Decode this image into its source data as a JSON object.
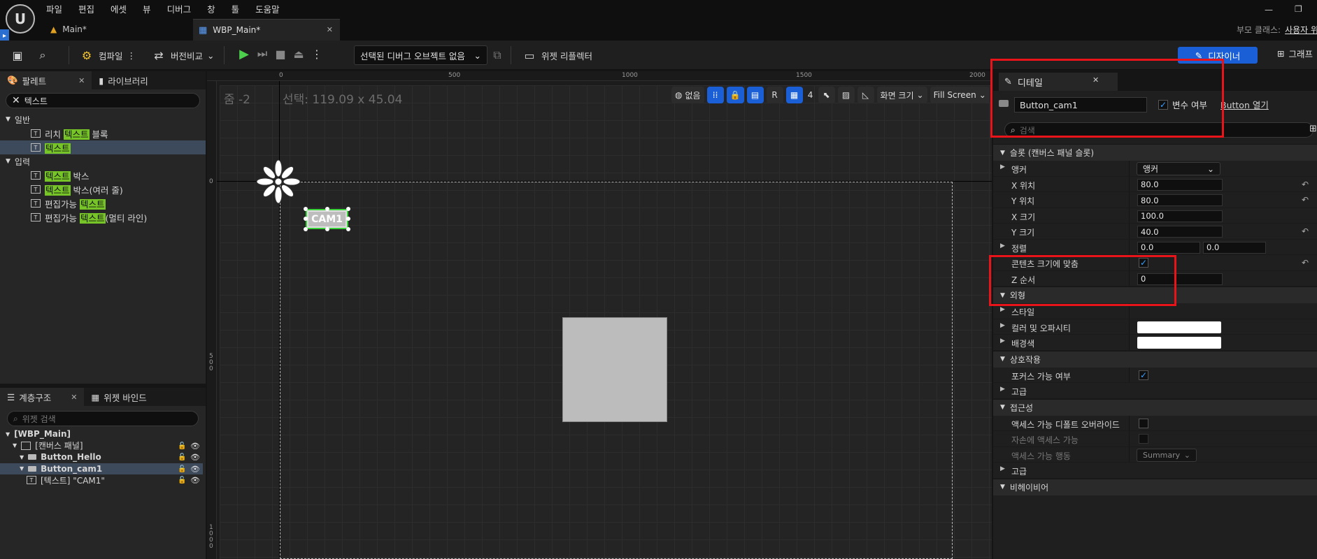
{
  "menu": [
    "파일",
    "편집",
    "에셋",
    "뷰",
    "디버그",
    "창",
    "툴",
    "도움말"
  ],
  "tabs": {
    "main": "Main*",
    "wbp": "WBP_Main*"
  },
  "parent_class": {
    "label": "부모 클래스:",
    "value": "사용자 위"
  },
  "toolbar": {
    "compile": "컴파일",
    "diff": "버전비교",
    "debug_object": "선택된 디버그 오브젝트 없음",
    "widget_reflector": "위젯 리플렉터",
    "designer": "디자이너",
    "graph": "그래프"
  },
  "palette": {
    "tab": "팔레트",
    "library_tab": "라이브러리",
    "search_value": "텍스트",
    "categories": [
      {
        "name": "일반",
        "items": [
          {
            "prefix": "리치 ",
            "hl": "텍스트",
            "suffix": " 블록",
            "icon": "rich-text-icon",
            "sel": false
          },
          {
            "prefix": "",
            "hl": "텍스트",
            "suffix": "",
            "icon": "text-icon",
            "sel": true
          }
        ]
      },
      {
        "name": "입력",
        "items": [
          {
            "prefix": "",
            "hl": "텍스트",
            "suffix": " 박스",
            "icon": "textbox-icon",
            "sel": false
          },
          {
            "prefix": "",
            "hl": "텍스트",
            "suffix": " 박스(여러 줄)",
            "icon": "textbox-multi-icon",
            "sel": false
          },
          {
            "prefix": "편집가능 ",
            "hl": "텍스트",
            "suffix": "",
            "icon": "editable-text-icon",
            "sel": false
          },
          {
            "prefix": "편집가능 ",
            "hl": "텍스트",
            "suffix": "(멀티 라인)",
            "icon": "editable-text-multi-icon",
            "sel": false
          }
        ]
      }
    ]
  },
  "hierarchy": {
    "tab": "계층구조",
    "bind_tab": "위젯 바인드",
    "search_placeholder": "위젯 검색",
    "items": [
      {
        "label": "[WBP_Main]",
        "level": 0,
        "sel": false
      },
      {
        "label": "[캔버스 패널]",
        "level": 1,
        "sel": false
      },
      {
        "label": "Button_Hello",
        "level": 2,
        "sel": false
      },
      {
        "label": "Button_cam1",
        "level": 2,
        "sel": true
      },
      {
        "label": "[텍스트] \"CAM1\"",
        "level": 3,
        "sel": false
      }
    ]
  },
  "canvas": {
    "zoom": "줌 -2",
    "selection": "선택: 119.09 x 45.04",
    "ruler_top": [
      "0",
      "500",
      "1000",
      "1500",
      "2000"
    ],
    "ruler_left": [
      "0",
      "5\n0\n0",
      "1\n0\n0\n0"
    ],
    "none_label": "없음",
    "r_label": "R",
    "grid_snap": "4",
    "screen_size": "화면 크기",
    "fill_screen": "Fill Screen",
    "button_text": "CAM1"
  },
  "details": {
    "tab": "디테일",
    "name": "Button_cam1",
    "is_variable": "변수 여부",
    "open_button": "Button 열기",
    "search_placeholder": "검색",
    "sections": [
      {
        "title": "슬롯 (캔버스 패널 슬롯)",
        "rows": [
          {
            "label": "앵커",
            "type": "dropdown",
            "value": "앵커",
            "expander": true
          },
          {
            "label": "X 위치",
            "type": "num",
            "value": "80.0",
            "reset": true
          },
          {
            "label": "Y 위치",
            "type": "num",
            "value": "80.0",
            "reset": true
          },
          {
            "label": "X 크기",
            "type": "num",
            "value": "100.0"
          },
          {
            "label": "Y 크기",
            "type": "num",
            "value": "40.0",
            "reset": true
          },
          {
            "label": "정렬",
            "type": "num2",
            "value": "0.0",
            "value2": "0.0",
            "expander": true
          },
          {
            "label": "콘텐츠 크기에 맞춤",
            "type": "check",
            "checked": true,
            "reset": true
          },
          {
            "label": "Z 순서",
            "type": "num",
            "value": "0"
          }
        ]
      },
      {
        "title": "외형",
        "rows": [
          {
            "label": "스타일",
            "type": "none",
            "expander": true
          },
          {
            "label": "컬러 및 오파시티",
            "type": "color",
            "expander": true
          },
          {
            "label": "배경색",
            "type": "color",
            "expander": true
          }
        ]
      },
      {
        "title": "상호작용",
        "rows": [
          {
            "label": "포커스 가능 여부",
            "type": "check",
            "checked": true
          },
          {
            "label": "고급",
            "type": "none",
            "expander": true,
            "nolbl_indent": true
          }
        ]
      },
      {
        "title": "접근성",
        "rows": [
          {
            "label": "액세스 가능 디폴트 오버라이드",
            "type": "check",
            "checked": false
          },
          {
            "label": "자손에 액세스 가능",
            "type": "check",
            "checked": false,
            "dim": true
          },
          {
            "label": "액세스 가능 행동",
            "type": "dropdown",
            "value": "Summary",
            "dim": true
          },
          {
            "label": "고급",
            "type": "none",
            "expander": true,
            "nolbl_indent": true
          }
        ]
      },
      {
        "title": "비헤이비어",
        "rows": []
      }
    ]
  }
}
